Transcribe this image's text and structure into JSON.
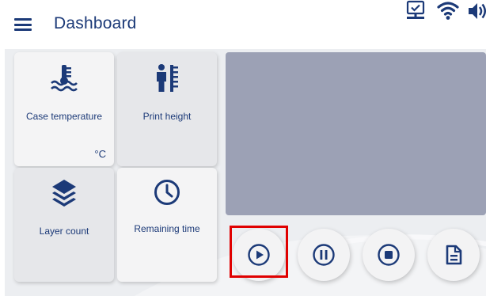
{
  "header": {
    "title": "Dashboard",
    "menu_icon": "hamburger-menu-icon",
    "status_icons": [
      "network-status-icon",
      "wifi-icon",
      "volume-icon"
    ]
  },
  "tiles": [
    {
      "id": "case-temperature",
      "label": "Case temperature",
      "unit": "°C",
      "icon": "temperature-icon"
    },
    {
      "id": "print-height",
      "label": "Print height",
      "icon": "height-icon"
    },
    {
      "id": "layer-count",
      "label": "Layer count",
      "icon": "layers-icon"
    },
    {
      "id": "remaining-time",
      "label": "Remaining time",
      "icon": "clock-icon"
    }
  ],
  "controls": [
    {
      "id": "play",
      "icon": "play-icon",
      "highlighted": true
    },
    {
      "id": "pause",
      "icon": "pause-icon"
    },
    {
      "id": "stop",
      "icon": "stop-icon"
    },
    {
      "id": "file",
      "icon": "document-icon"
    }
  ],
  "colors": {
    "primary": "#1c3a78",
    "screen": "#9ca1b5",
    "highlight": "#e00000",
    "background": "#eceef1"
  }
}
